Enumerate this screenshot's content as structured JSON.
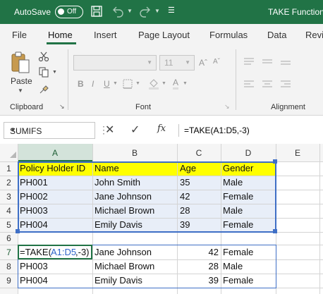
{
  "titlebar": {
    "autosave_label": "AutoSave",
    "toggle_state": "Off",
    "doc_title": "TAKE Function"
  },
  "tabs": [
    "File",
    "Home",
    "Insert",
    "Page Layout",
    "Formulas",
    "Data",
    "Revi"
  ],
  "active_tab": "Home",
  "ribbon": {
    "paste_label": "Paste",
    "font_size": "11",
    "group_clipboard": "Clipboard",
    "group_font": "Font",
    "group_alignment": "Alignment"
  },
  "formula_bar": {
    "name_box": "SUMIFS",
    "fx_label": "fx",
    "formula": "=TAKE(A1:D5,-3)"
  },
  "grid": {
    "columns": [
      "A",
      "B",
      "C",
      "D",
      "E"
    ],
    "rows": [
      "1",
      "2",
      "3",
      "4",
      "5",
      "6",
      "7",
      "8",
      "9"
    ],
    "table_header": [
      "Policy Holder ID",
      "Name",
      "Age",
      "Gender"
    ],
    "table_rows": [
      [
        "PH001",
        "John Smith",
        "35",
        "Male"
      ],
      [
        "PH002",
        "Jane Johnson",
        "42",
        "Female"
      ],
      [
        "PH003",
        "Michael Brown",
        "28",
        "Male"
      ],
      [
        "PH004",
        "Emily Davis",
        "39",
        "Female"
      ]
    ],
    "edit_cell": {
      "prefix": "=TAKE(",
      "ref": "A1:D5",
      "suffix": ",-3)"
    },
    "result_rows": [
      [
        "",
        "Jane Johnson",
        "42",
        "Female"
      ],
      [
        "PH003",
        "Michael Brown",
        "28",
        "Male"
      ],
      [
        "PH004",
        "Emily Davis",
        "39",
        "Female"
      ]
    ]
  },
  "colors": {
    "excel_green": "#217346",
    "header_yellow": "#ffff00",
    "range_fill": "#e8eef8",
    "range_border": "#3f6fc6",
    "ref_blue": "#2e63c9"
  }
}
